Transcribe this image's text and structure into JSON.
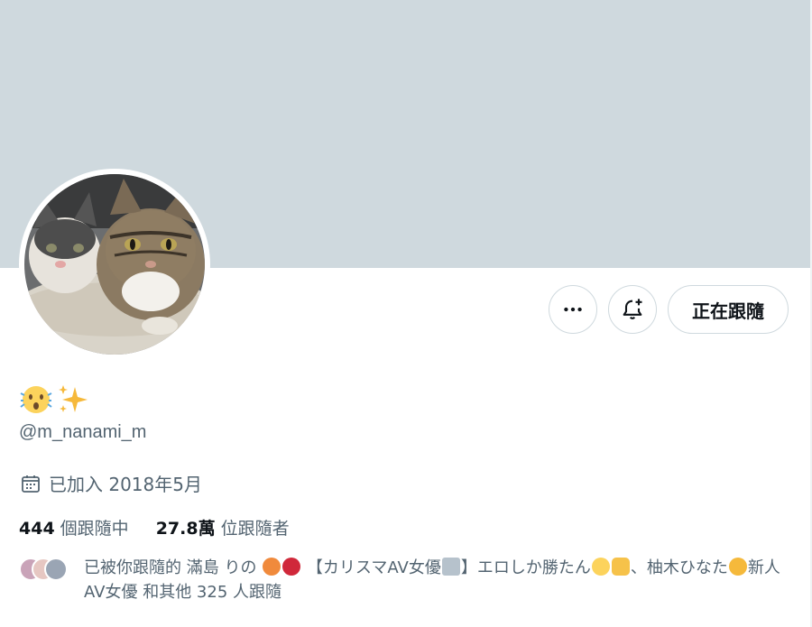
{
  "profile": {
    "display_name_icons": [
      "face-with-open-mouth-emoji",
      "sparkles-emoji"
    ],
    "handle": "@m_nanami_m",
    "joined": "已加入 2018年5月"
  },
  "actions": {
    "more_icon": "ellipsis-icon",
    "notify_icon": "bell-plus-icon",
    "following_label": "正在跟隨"
  },
  "stats": {
    "following_count": "444",
    "following_label": "個跟隨中",
    "followers_count": "27.8萬",
    "followers_label": "位跟隨者"
  },
  "mutual": {
    "prefix": "已被你跟隨的 滿島 りの",
    "mid1": "【カリスマAV女優",
    "mid2": "】エロしか勝たん",
    "mid3": "、柚木ひなた",
    "mid4": "新人AV女優 和其他 325 人跟隨"
  },
  "colors": {
    "banner": "#cfd9de",
    "secondary_text": "#536471",
    "primary_text": "#0f1419",
    "border": "#cfd9de"
  }
}
